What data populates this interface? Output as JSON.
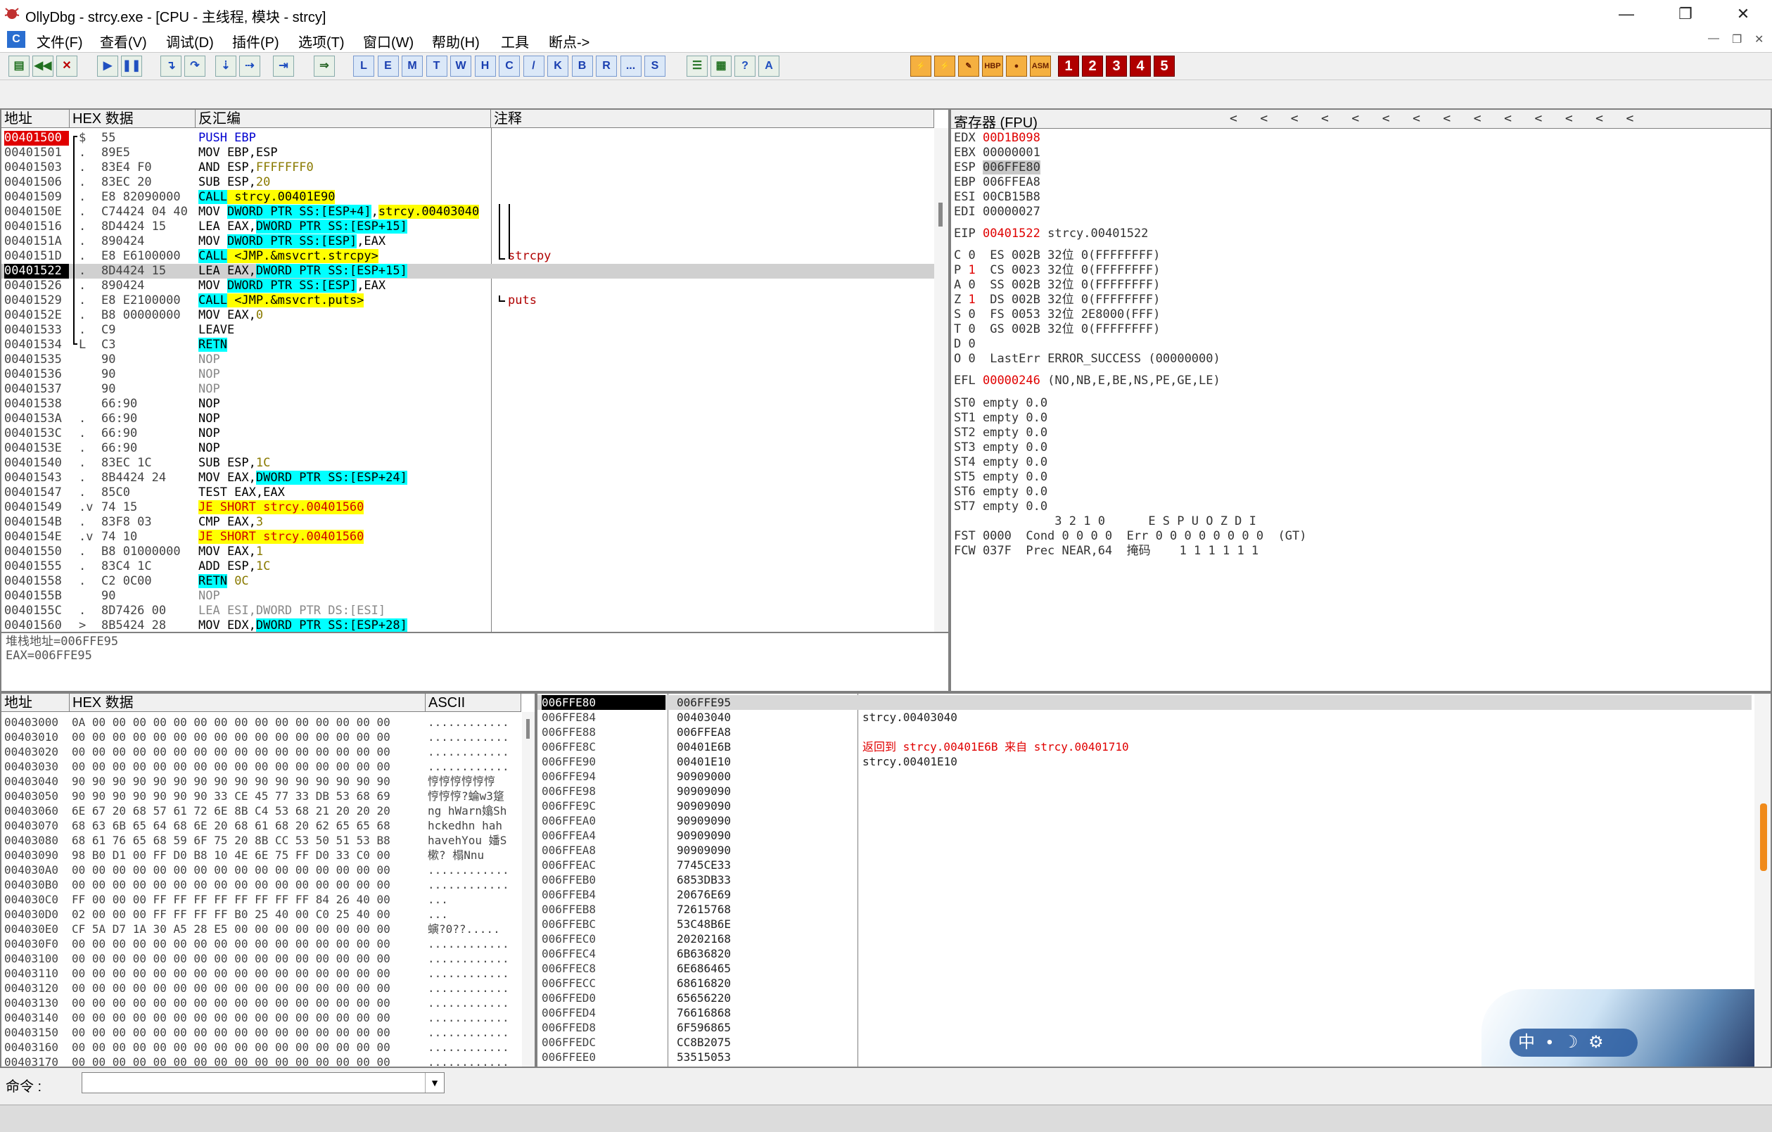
{
  "window": {
    "title": "OllyDbg - strcy.exe - [CPU -  主线程, 模块 - strcy]",
    "minimize": "—",
    "restore": "❐",
    "close": "✕"
  },
  "menu": [
    "文件(F)",
    "查看(V)",
    "调试(D)",
    "插件(P)",
    "选项(T)",
    "窗口(W)",
    "帮助(H)",
    "工具",
    "断点->"
  ],
  "toolbar": {
    "letters": [
      "L",
      "E",
      "M",
      "T",
      "W",
      "H",
      "C",
      "/",
      "K",
      "B",
      "R",
      "...",
      "S"
    ],
    "right_labels": [
      "HBP",
      "ASM"
    ],
    "numbers": [
      "1",
      "2",
      "3",
      "4",
      "5"
    ]
  },
  "disasm": {
    "headers": {
      "addr": "地址",
      "hex": "HEX 数据",
      "asm": "反汇编",
      "comment": "注释"
    },
    "rows": [
      {
        "addr": "00401500",
        "mark": "$",
        "hex": "55",
        "asm": [
          {
            "t": "PUSH EBP",
            "c": "blue"
          }
        ],
        "cmt": "",
        "addr_style": "red"
      },
      {
        "addr": "00401501",
        "mark": ".",
        "hex": "89E5",
        "asm": [
          {
            "t": "MOV EBP,ESP"
          }
        ],
        "cmt": ""
      },
      {
        "addr": "00401503",
        "mark": ".",
        "hex": "83E4 F0",
        "asm": [
          {
            "t": "AND ESP,"
          },
          {
            "t": "FFFFFFF0",
            "c": "olive"
          }
        ],
        "cmt": ""
      },
      {
        "addr": "00401506",
        "mark": ".",
        "hex": "83EC 20",
        "asm": [
          {
            "t": "SUB ESP,"
          },
          {
            "t": "20",
            "c": "olive"
          }
        ],
        "cmt": ""
      },
      {
        "addr": "00401509",
        "mark": ".",
        "hex": "E8 82090000",
        "asm": [
          {
            "t": "CALL",
            "h": "cyan"
          },
          {
            "t": " strcy.00401E90",
            "h": "yellow"
          }
        ],
        "cmt": ""
      },
      {
        "addr": "0040150E",
        "mark": ".",
        "hex": "C74424 04 40",
        "asm": [
          {
            "t": "MOV "
          },
          {
            "t": "DWORD PTR SS:[ESP+4]",
            "h": "cyan"
          },
          {
            "t": ","
          },
          {
            "t": "strcy.00403040",
            "h": "yellow"
          }
        ],
        "cmt": ""
      },
      {
        "addr": "00401516",
        "mark": ".",
        "hex": "8D4424 15",
        "asm": [
          {
            "t": "LEA EAX,"
          },
          {
            "t": "DWORD PTR SS:[ESP+15]",
            "h": "cyan"
          }
        ],
        "cmt": ""
      },
      {
        "addr": "0040151A",
        "mark": ".",
        "hex": "890424",
        "asm": [
          {
            "t": "MOV "
          },
          {
            "t": "DWORD PTR SS:[ESP]",
            "h": "cyan"
          },
          {
            "t": ",EAX"
          }
        ],
        "cmt": ""
      },
      {
        "addr": "0040151D",
        "mark": ".",
        "hex": "E8 E6100000",
        "asm": [
          {
            "t": "CALL",
            "h": "cyan"
          },
          {
            "t": " <JMP.&msvcrt.strcpy>",
            "h": "yellow"
          }
        ],
        "cmt": "strcpy"
      },
      {
        "addr": "00401522",
        "mark": ".",
        "hex": "8D4424 15",
        "asm": [
          {
            "t": "LEA EAX,"
          },
          {
            "t": "DWORD PTR SS:[ESP+15]",
            "h": "cyan"
          }
        ],
        "cmt": "",
        "addr_style": "black",
        "row_style": "sel"
      },
      {
        "addr": "00401526",
        "mark": ".",
        "hex": "890424",
        "asm": [
          {
            "t": "MOV "
          },
          {
            "t": "DWORD PTR SS:[ESP]",
            "h": "cyan"
          },
          {
            "t": ",EAX"
          }
        ],
        "cmt": ""
      },
      {
        "addr": "00401529",
        "mark": ".",
        "hex": "E8 E2100000",
        "asm": [
          {
            "t": "CALL",
            "h": "cyan"
          },
          {
            "t": " <JMP.&msvcrt.puts>",
            "h": "yellow"
          }
        ],
        "cmt": "puts"
      },
      {
        "addr": "0040152E",
        "mark": ".",
        "hex": "B8 00000000",
        "asm": [
          {
            "t": "MOV EAX,"
          },
          {
            "t": "0",
            "c": "olive"
          }
        ],
        "cmt": ""
      },
      {
        "addr": "00401533",
        "mark": ".",
        "hex": "C9",
        "asm": [
          {
            "t": "LEAVE"
          }
        ],
        "cmt": ""
      },
      {
        "addr": "00401534",
        "mark": "L",
        "hex": "C3",
        "asm": [
          {
            "t": "RETN",
            "h": "cyan"
          }
        ],
        "cmt": ""
      },
      {
        "addr": "00401535",
        "mark": "",
        "hex": "90",
        "asm": [
          {
            "t": "NOP",
            "c": "gray"
          }
        ],
        "cmt": ""
      },
      {
        "addr": "00401536",
        "mark": "",
        "hex": "90",
        "asm": [
          {
            "t": "NOP",
            "c": "gray"
          }
        ],
        "cmt": ""
      },
      {
        "addr": "00401537",
        "mark": "",
        "hex": "90",
        "asm": [
          {
            "t": "NOP",
            "c": "gray"
          }
        ],
        "cmt": ""
      },
      {
        "addr": "00401538",
        "mark": "",
        "hex": "66:90",
        "asm": [
          {
            "t": "NOP"
          }
        ],
        "cmt": ""
      },
      {
        "addr": "0040153A",
        "mark": ".",
        "hex": "66:90",
        "asm": [
          {
            "t": "NOP"
          }
        ],
        "cmt": ""
      },
      {
        "addr": "0040153C",
        "mark": ".",
        "hex": "66:90",
        "asm": [
          {
            "t": "NOP"
          }
        ],
        "cmt": ""
      },
      {
        "addr": "0040153E",
        "mark": ".",
        "hex": "66:90",
        "asm": [
          {
            "t": "NOP"
          }
        ],
        "cmt": ""
      },
      {
        "addr": "00401540",
        "mark": ".",
        "hex": "83EC 1C",
        "asm": [
          {
            "t": "SUB ESP,"
          },
          {
            "t": "1C",
            "c": "olive"
          }
        ],
        "cmt": ""
      },
      {
        "addr": "00401543",
        "mark": ".",
        "hex": "8B4424 24",
        "asm": [
          {
            "t": "MOV EAX,"
          },
          {
            "t": "DWORD PTR SS:[ESP+24]",
            "h": "cyan"
          }
        ],
        "cmt": ""
      },
      {
        "addr": "00401547",
        "mark": ".",
        "hex": "85C0",
        "asm": [
          {
            "t": "TEST EAX,EAX"
          }
        ],
        "cmt": ""
      },
      {
        "addr": "00401549",
        "mark": ".v",
        "hex": "74 15",
        "asm": [
          {
            "t": "JE SHORT strcy.00401560",
            "h": "yellow",
            "c": "red"
          }
        ],
        "cmt": ""
      },
      {
        "addr": "0040154B",
        "mark": ".",
        "hex": "83F8 03",
        "asm": [
          {
            "t": "CMP EAX,"
          },
          {
            "t": "3",
            "c": "olive"
          }
        ],
        "cmt": ""
      },
      {
        "addr": "0040154E",
        "mark": ".v",
        "hex": "74 10",
        "asm": [
          {
            "t": "JE SHORT strcy.00401560",
            "h": "yellow",
            "c": "red"
          }
        ],
        "cmt": ""
      },
      {
        "addr": "00401550",
        "mark": ".",
        "hex": "B8 01000000",
        "asm": [
          {
            "t": "MOV EAX,"
          },
          {
            "t": "1",
            "c": "olive"
          }
        ],
        "cmt": ""
      },
      {
        "addr": "00401555",
        "mark": ".",
        "hex": "83C4 1C",
        "asm": [
          {
            "t": "ADD ESP,"
          },
          {
            "t": "1C",
            "c": "olive"
          }
        ],
        "cmt": ""
      },
      {
        "addr": "00401558",
        "mark": ".",
        "hex": "C2 0C00",
        "asm": [
          {
            "t": "RETN",
            "h": "cyan"
          },
          {
            "t": " 0C",
            "c": "olive"
          }
        ],
        "cmt": ""
      },
      {
        "addr": "0040155B",
        "mark": "",
        "hex": "90",
        "asm": [
          {
            "t": "NOP",
            "c": "gray"
          }
        ],
        "cmt": ""
      },
      {
        "addr": "0040155C",
        "mark": ".",
        "hex": "8D7426 00",
        "asm": [
          {
            "t": "LEA ESI,DWORD PTR DS:[ESI]",
            "c": "gray"
          }
        ],
        "cmt": ""
      },
      {
        "addr": "00401560",
        "mark": ">",
        "hex": "8B5424 28",
        "asm": [
          {
            "t": "MOV EDX,"
          },
          {
            "t": "DWORD PTR SS:[ESP+28]",
            "h": "cyan"
          }
        ],
        "cmt": ""
      }
    ]
  },
  "info_pane": [
    "堆栈地址=006FFE95",
    "EAX=006FFE95"
  ],
  "registers": {
    "header": "寄存器 (FPU)",
    "arrows": "<   <   <   <   <   <   <   <   <   <   <   <   <   <",
    "gp": [
      {
        "name": "EDX",
        "value": "00D1B098",
        "red": true,
        "note": ""
      },
      {
        "name": "EBX",
        "value": "00000001",
        "red": false,
        "note": ""
      },
      {
        "name": "ESP",
        "value": "006FFE80",
        "red": false,
        "note": "",
        "box": true
      },
      {
        "name": "EBP",
        "value": "006FFEA8",
        "red": false,
        "note": ""
      },
      {
        "name": "ESI",
        "value": "00CB15B8",
        "red": false,
        "note": ""
      },
      {
        "name": "EDI",
        "value": "00000027",
        "red": false,
        "note": ""
      }
    ],
    "eip": {
      "name": "EIP",
      "value": "00401522",
      "note": "strcy.00401522"
    },
    "flags": [
      {
        "f": "C",
        "v": "0",
        "seg": "ES 002B 32位 0(FFFFFFFF)",
        "red": false
      },
      {
        "f": "P",
        "v": "1",
        "seg": "CS 0023 32位 0(FFFFFFFF)",
        "red": true
      },
      {
        "f": "A",
        "v": "0",
        "seg": "SS 002B 32位 0(FFFFFFFF)",
        "red": false
      },
      {
        "f": "Z",
        "v": "1",
        "seg": "DS 002B 32位 0(FFFFFFFF)",
        "red": true
      },
      {
        "f": "S",
        "v": "0",
        "seg": "FS 0053 32位 2E8000(FFF)",
        "red": false
      },
      {
        "f": "T",
        "v": "0",
        "seg": "GS 002B 32位 0(FFFFFFFF)",
        "red": false
      },
      {
        "f": "D",
        "v": "0",
        "seg": "",
        "red": false
      },
      {
        "f": "O",
        "v": "0",
        "seg": "LastErr ERROR_SUCCESS (00000000)",
        "red": false
      }
    ],
    "efl": {
      "name": "EFL",
      "value": "00000246",
      "note": "(NO,NB,E,BE,NS,PE,GE,LE)"
    },
    "st": [
      "ST0 empty 0.0",
      "ST1 empty 0.0",
      "ST2 empty 0.0",
      "ST3 empty 0.0",
      "ST4 empty 0.0",
      "ST5 empty 0.0",
      "ST6 empty 0.0",
      "ST7 empty 0.0"
    ],
    "fpu_hdr": "              3 2 1 0      E S P U O Z D I",
    "fst": "FST 0000  Cond 0 0 0 0  Err 0 0 0 0 0 0 0 0  (GT)",
    "fcw": "FCW 037F  Prec NEAR,64  掩码    1 1 1 1 1 1"
  },
  "dump": {
    "headers": {
      "addr": "地址",
      "hex": "HEX 数据",
      "ascii": "ASCII"
    },
    "rows": [
      {
        "a": "00403000",
        "h": "0A 00 00 00 00 00 00 00 00 00 00 00 00 00 00 00",
        "s": "............"
      },
      {
        "a": "00403010",
        "h": "00 00 00 00 00 00 00 00 00 00 00 00 00 00 00 00",
        "s": "............"
      },
      {
        "a": "00403020",
        "h": "00 00 00 00 00 00 00 00 00 00 00 00 00 00 00 00",
        "s": "............"
      },
      {
        "a": "00403030",
        "h": "00 00 00 00 00 00 00 00 00 00 00 00 00 00 00 00",
        "s": "............"
      },
      {
        "a": "00403040",
        "h": "90 90 90 90 90 90 90 90 90 90 90 90 90 90 90 90",
        "s": "悙悙悙悙悙悙"
      },
      {
        "a": "00403050",
        "h": "90 90 90 90 90 90 90 33 CE 45 77 33 DB 53 68 69",
        "s": "悙悙悙?蜦w3跾"
      },
      {
        "a": "00403060",
        "h": "6E 67 20 68 57 61 72 6E 8B C4 53 68 21 20 20 20",
        "s": "ng hWarn嬆Sh"
      },
      {
        "a": "00403070",
        "h": "68 63 6B 65 64 68 6E 20 68 61 68 20 62 65 65 68",
        "s": "hckedhn hah"
      },
      {
        "a": "00403080",
        "h": "68 61 76 65 68 59 6F 75 20 8B CC 53 50 51 53 B8",
        "s": "havehYou 嬏S"
      },
      {
        "a": "00403090",
        "h": "98 B0 D1 00 FF D0 B8 10 4E 6E 75 FF D0 33 C0 00",
        "s": "樕?  榻Nnu"
      },
      {
        "a": "004030A0",
        "h": "00 00 00 00 00 00 00 00 00 00 00 00 00 00 00 00",
        "s": "............"
      },
      {
        "a": "004030B0",
        "h": "00 00 00 00 00 00 00 00 00 00 00 00 00 00 00 00",
        "s": "............"
      },
      {
        "a": "004030C0",
        "h": "FF 00 00 00 FF FF FF FF FF FF FF FF 84 26 40 00",
        "s": "    ...    "
      },
      {
        "a": "004030D0",
        "h": "02 00 00 00 FF FF FF FF B0 25 40 00 C0 25 40 00",
        "s": "...        "
      },
      {
        "a": "004030E0",
        "h": "CF 5A D7 1A 30 A5 28 E5 00 00 00 00 00 00 00 00",
        "s": "螾?0??....."
      },
      {
        "a": "004030F0",
        "h": "00 00 00 00 00 00 00 00 00 00 00 00 00 00 00 00",
        "s": "............"
      },
      {
        "a": "00403100",
        "h": "00 00 00 00 00 00 00 00 00 00 00 00 00 00 00 00",
        "s": "............"
      },
      {
        "a": "00403110",
        "h": "00 00 00 00 00 00 00 00 00 00 00 00 00 00 00 00",
        "s": "............"
      },
      {
        "a": "00403120",
        "h": "00 00 00 00 00 00 00 00 00 00 00 00 00 00 00 00",
        "s": "............"
      },
      {
        "a": "00403130",
        "h": "00 00 00 00 00 00 00 00 00 00 00 00 00 00 00 00",
        "s": "............"
      },
      {
        "a": "00403140",
        "h": "00 00 00 00 00 00 00 00 00 00 00 00 00 00 00 00",
        "s": "............"
      },
      {
        "a": "00403150",
        "h": "00 00 00 00 00 00 00 00 00 00 00 00 00 00 00 00",
        "s": "............"
      },
      {
        "a": "00403160",
        "h": "00 00 00 00 00 00 00 00 00 00 00 00 00 00 00 00",
        "s": "............"
      },
      {
        "a": "00403170",
        "h": "00 00 00 00 00 00 00 00 00 00 00 00 00 00 00 00",
        "s": "............"
      }
    ]
  },
  "stack": {
    "rows": [
      {
        "a": "006FFE80",
        "v": "006FFE95",
        "c": "",
        "sel": true
      },
      {
        "a": "006FFE84",
        "v": "00403040",
        "c": "strcy.00403040"
      },
      {
        "a": "006FFE88",
        "v": "006FFEA8",
        "c": ""
      },
      {
        "a": "006FFE8C",
        "v": "00401E6B",
        "c": "返回到 strcy.00401E6B 来自 strcy.00401710",
        "red": true
      },
      {
        "a": "006FFE90",
        "v": "00401E10",
        "c": "strcy.00401E10"
      },
      {
        "a": "006FFE94",
        "v": "90909000",
        "c": ""
      },
      {
        "a": "006FFE98",
        "v": "90909090",
        "c": ""
      },
      {
        "a": "006FFE9C",
        "v": "90909090",
        "c": ""
      },
      {
        "a": "006FFEA0",
        "v": "90909090",
        "c": ""
      },
      {
        "a": "006FFEA4",
        "v": "90909090",
        "c": ""
      },
      {
        "a": "006FFEA8",
        "v": "90909090",
        "c": ""
      },
      {
        "a": "006FFEAC",
        "v": "7745CE33",
        "c": ""
      },
      {
        "a": "006FFEB0",
        "v": "6853DB33",
        "c": ""
      },
      {
        "a": "006FFEB4",
        "v": "20676E69",
        "c": ""
      },
      {
        "a": "006FFEB8",
        "v": "72615768",
        "c": ""
      },
      {
        "a": "006FFEBC",
        "v": "53C48B6E",
        "c": ""
      },
      {
        "a": "006FFEC0",
        "v": "20202168",
        "c": ""
      },
      {
        "a": "006FFEC4",
        "v": "6B636820",
        "c": ""
      },
      {
        "a": "006FFEC8",
        "v": "6E686465",
        "c": ""
      },
      {
        "a": "006FFECC",
        "v": "68616820",
        "c": ""
      },
      {
        "a": "006FFED0",
        "v": "65656220",
        "c": ""
      },
      {
        "a": "006FFED4",
        "v": "76616868",
        "c": ""
      },
      {
        "a": "006FFED8",
        "v": "6F596865",
        "c": ""
      },
      {
        "a": "006FFEDC",
        "v": "CC8B2075",
        "c": ""
      },
      {
        "a": "006FFEE0",
        "v": "53515053",
        "c": ""
      }
    ]
  },
  "command": {
    "label": "命令 :",
    "value": ""
  },
  "ime": {
    "lang": "中",
    "punct": "•",
    "moon": "☽",
    "settings": "⚙"
  }
}
